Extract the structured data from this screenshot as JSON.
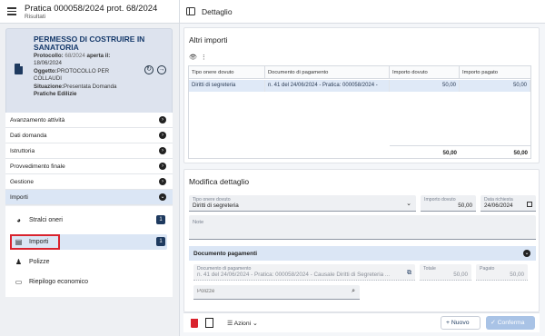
{
  "header": {
    "title": "Pratica 000058/2024 prot. 68/2024",
    "subtitle": "Risultati",
    "detail_title": "Dettaglio"
  },
  "card": {
    "title": "PERMESSO DI COSTRUIRE IN SANATORIA",
    "protocollo_label": "Protocollo:",
    "protocollo_value": "68/2024",
    "aperta_label": "aperta il:",
    "aperta_value": "18/06/2024",
    "oggetto_label": "Oggetto:",
    "oggetto_value": "PROTOCOLLO PER COLLAUDI",
    "situazione_label": "Situazione:",
    "situazione_value": "Presentata Domanda",
    "category": "Pratiche Edilizie"
  },
  "accordion": [
    {
      "label": "Avanzamento attività"
    },
    {
      "label": "Dati domanda"
    },
    {
      "label": "Istruttoria"
    },
    {
      "label": "Provvedimento finale"
    },
    {
      "label": "Gestione"
    },
    {
      "label": "Importi"
    }
  ],
  "subitems": [
    {
      "label": "Stralci oneri",
      "count": "1",
      "icon": "pie-chart-icon"
    },
    {
      "label": "Importi",
      "count": "1",
      "icon": "money-icon"
    },
    {
      "label": "Polizze",
      "icon": "person-icon"
    },
    {
      "label": "Riepilogo economico",
      "icon": "document-icon"
    }
  ],
  "altri_importi": {
    "title": "Altri importi",
    "columns": [
      "Tipo onere dovuto",
      "Documento di pagamento",
      "Importo dovuto",
      "Importo pagato"
    ],
    "rows": [
      [
        "Diritti di segreteria",
        "n. 41 del 24/06/2024 - Pratica: 000058/2024 -",
        "50,00",
        "50,00"
      ]
    ],
    "totals": [
      "50,00",
      "50,00"
    ]
  },
  "modifica": {
    "title": "Modifica dettaglio",
    "tipo_label": "Tipo onere dovuto",
    "tipo_value": "Diritti di segreteria",
    "importo_label": "Importo dovuto",
    "importo_value": "50,00",
    "data_label": "Data richiesta",
    "data_value": "24/06/2024",
    "note_label": "Note",
    "pagamenti_title": "Documento pagamenti",
    "doc_label": "Documento di pagamento",
    "doc_value": "n. 41 del 24/06/2024 - Pratica: 000058/2024 - Causale Diritti di Segreteria ...",
    "totale_label": "Totale",
    "totale_value": "50,00",
    "pagato_label": "Pagato",
    "pagato_value": "50,00",
    "polizze_placeholder": "Polizze"
  },
  "footer": {
    "azioni": "Azioni",
    "nuovo": "+ Nuovo",
    "conferma": "✓ Conferma"
  },
  "colors": {
    "primary": "#1e3a5f",
    "selection": "#dbe6f5",
    "highlight_border": "#d9232e"
  }
}
